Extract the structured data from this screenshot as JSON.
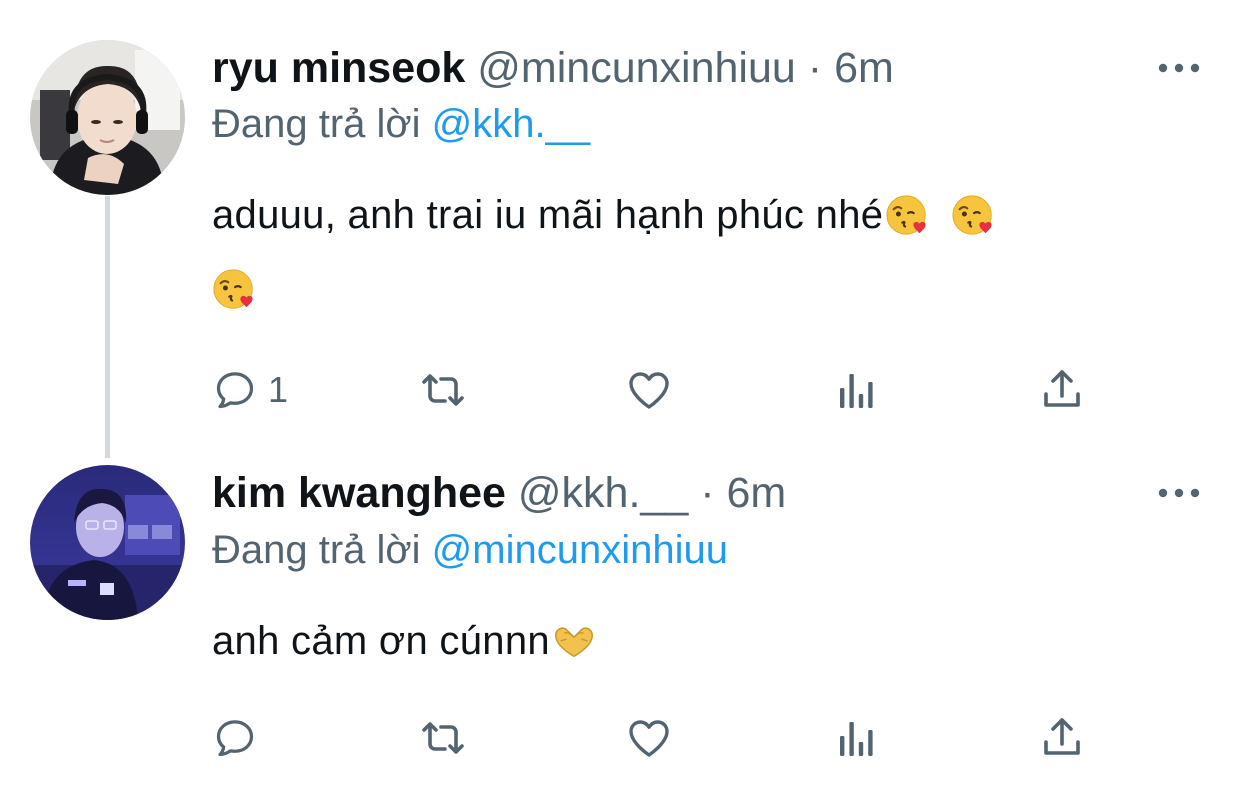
{
  "thread": [
    {
      "author": {
        "display_name": "ryu minseok",
        "handle": "@mincunxinhiuu",
        "time": "6m",
        "avatar": "person-with-headset-avatar"
      },
      "replying_prefix": "Đang trả lời",
      "replying_to": "@kkh.__",
      "text": "aduuu, anh trai iu mãi hạnh phúc nhé",
      "emojis": [
        "kissing-face-heart-emoji",
        "kissing-face-heart-emoji",
        "kissing-face-heart-emoji"
      ],
      "actions": {
        "reply_count": "1",
        "retweet_count": "",
        "like_count": ""
      }
    },
    {
      "author": {
        "display_name": "kim kwanghee",
        "handle": "@kkh.__",
        "time": "6m",
        "avatar": "person-on-stage-avatar"
      },
      "replying_prefix": "Đang trả lời",
      "replying_to": "@mincunxinhiuu",
      "text": "anh cảm ơn cúnnn",
      "emojis": [
        "heart-hands-emoji"
      ],
      "actions": {
        "reply_count": "",
        "retweet_count": "",
        "like_count": ""
      }
    }
  ],
  "separator": "·",
  "icons": {
    "reply": "reply-icon",
    "retweet": "retweet-icon",
    "like": "heart-icon",
    "analytics": "analytics-icon",
    "share": "share-icon",
    "more": "more-icon"
  },
  "colors": {
    "text_primary": "#0f1419",
    "text_secondary": "#536471",
    "link": "#1d9bf0",
    "thread_line": "#cfd9de"
  }
}
